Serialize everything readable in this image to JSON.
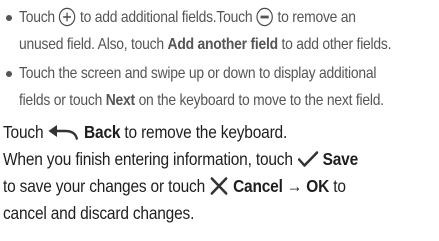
{
  "bullets": [
    {
      "line1": {
        "a": "Touch",
        "b": "to add additional fields.Touch",
        "c": "to remove an"
      },
      "line2": {
        "a": "unused field. Also, touch",
        "bold": "Add another field",
        "c": "to add other fields."
      }
    },
    {
      "line1": {
        "a": "Touch the screen and swipe up or down to display additional"
      },
      "line2": {
        "a": "fields or touch",
        "bold": "Next",
        "c": "on the keyboard to move to the next field."
      }
    }
  ],
  "para1": {
    "a": "Touch",
    "bold": "Back",
    "c": "to remove the keyboard."
  },
  "para2": {
    "line1": {
      "a": "When you finish entering information, touch",
      "bold": "Save"
    },
    "line2": {
      "a": "to save your changes or touch",
      "bold1": "Cancel",
      "arrow": "→",
      "bold2": "OK",
      "c": "to"
    },
    "line3": {
      "a": "cancel and discard changes."
    }
  },
  "icons": [
    "plus-circle-icon",
    "minus-circle-icon",
    "back-arrow-icon",
    "checkmark-icon",
    "x-mark-icon"
  ],
  "colors": {
    "minus_icon_fill": "#555555",
    "icon_stroke": "#333333"
  }
}
